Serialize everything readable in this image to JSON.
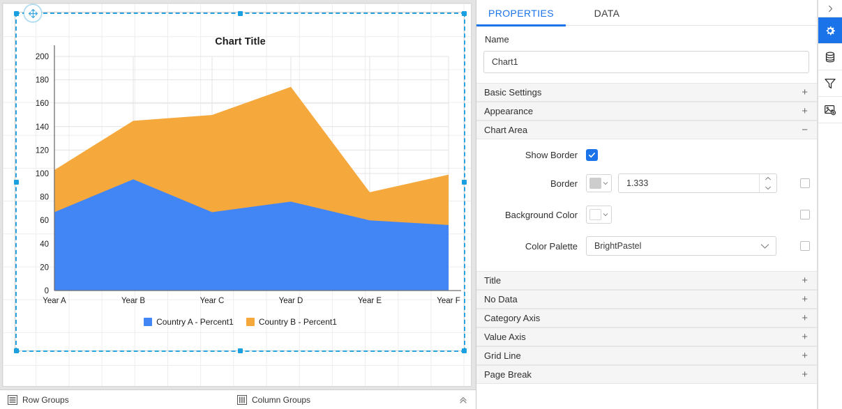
{
  "canvas": {
    "move_handle_icon": "move-cross-icon",
    "chart": {
      "title": "Chart Title",
      "legend": [
        {
          "label": "Country A - Percent1",
          "color": "#4285f4"
        },
        {
          "label": "Country B - Percent1",
          "color": "#f5a83c"
        }
      ]
    }
  },
  "chart_data": {
    "type": "area",
    "stacked": true,
    "title": "Chart Title",
    "xlabel": "",
    "ylabel": "",
    "categories": [
      "Year A",
      "Year B",
      "Year C",
      "Year D",
      "Year E",
      "Year F"
    ],
    "series": [
      {
        "name": "Country A - Percent1",
        "color": "#4285f4",
        "values": [
          67,
          95,
          67,
          76,
          60,
          56
        ]
      },
      {
        "name": "Country B - Percent1",
        "color": "#f5a83c",
        "values": [
          36,
          50,
          83,
          98,
          24,
          43
        ]
      }
    ],
    "cumulative_totals": [
      103,
      145,
      150,
      174,
      84,
      99
    ],
    "ylim": [
      0,
      200
    ],
    "yticks": [
      0,
      20,
      40,
      60,
      80,
      100,
      120,
      140,
      160,
      180,
      200
    ],
    "grid": true,
    "legend_position": "bottom"
  },
  "status_bar": {
    "row_groups": "Row Groups",
    "row_groups_icon": "rows-icon",
    "column_groups": "Column Groups",
    "column_groups_icon": "columns-icon",
    "collapse_icon": "chevron-double-up-icon"
  },
  "properties": {
    "tabs": [
      {
        "id": "properties",
        "label": "PROPERTIES",
        "active": true
      },
      {
        "id": "data",
        "label": "DATA",
        "active": false
      }
    ],
    "name_label": "Name",
    "name_value": "Chart1",
    "name_placeholder": "",
    "sections_top": [
      {
        "id": "basic-settings",
        "label": "Basic Settings",
        "sign": "+",
        "expanded": false
      },
      {
        "id": "appearance",
        "label": "Appearance",
        "sign": "+",
        "expanded": false
      },
      {
        "id": "chart-area",
        "label": "Chart Area",
        "sign": "−",
        "expanded": true
      }
    ],
    "chart_area": {
      "show_border_label": "Show Border",
      "show_border_checked": true,
      "border_label": "Border",
      "border_color": "#cdcdcd",
      "border_width": "1.333",
      "border_expr_checked": false,
      "background_color_label": "Background Color",
      "background_color": "#ffffff",
      "background_expr_checked": false,
      "color_palette_label": "Color Palette",
      "color_palette_value": "BrightPastel",
      "color_palette_expr_checked": false
    },
    "sections_bottom": [
      {
        "id": "title",
        "label": "Title",
        "sign": "+"
      },
      {
        "id": "no-data",
        "label": "No Data",
        "sign": "+"
      },
      {
        "id": "category-axis",
        "label": "Category Axis",
        "sign": "+"
      },
      {
        "id": "value-axis",
        "label": "Value Axis",
        "sign": "+"
      },
      {
        "id": "grid-line",
        "label": "Grid Line",
        "sign": "+"
      },
      {
        "id": "page-break",
        "label": "Page Break",
        "sign": "+"
      }
    ]
  },
  "rail": {
    "expand_icon": "chevron-right-icon",
    "items": [
      {
        "id": "settings",
        "icon": "gear-icon",
        "active": true
      },
      {
        "id": "data-source",
        "icon": "database-icon",
        "active": false
      },
      {
        "id": "filter",
        "icon": "funnel-icon",
        "active": false
      },
      {
        "id": "image-settings",
        "icon": "image-settings-icon",
        "active": false
      }
    ]
  },
  "theme": {
    "accent": "#1a73e8",
    "selection": "#29a3e0",
    "series_a": "#4285f4",
    "series_b": "#f5a83c"
  }
}
